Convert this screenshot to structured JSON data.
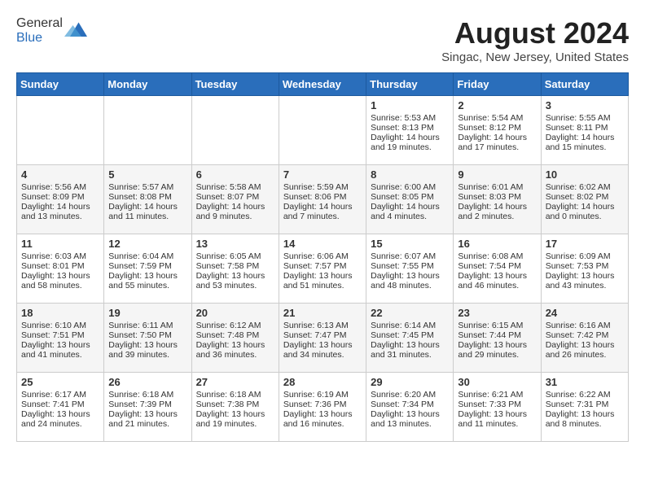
{
  "header": {
    "logo_general": "General",
    "logo_blue": "Blue",
    "month_title": "August 2024",
    "location": "Singac, New Jersey, United States"
  },
  "days_of_week": [
    "Sunday",
    "Monday",
    "Tuesday",
    "Wednesday",
    "Thursday",
    "Friday",
    "Saturday"
  ],
  "weeks": [
    [
      {
        "day": "",
        "content": ""
      },
      {
        "day": "",
        "content": ""
      },
      {
        "day": "",
        "content": ""
      },
      {
        "day": "",
        "content": ""
      },
      {
        "day": "1",
        "content": "Sunrise: 5:53 AM\nSunset: 8:13 PM\nDaylight: 14 hours\nand 19 minutes."
      },
      {
        "day": "2",
        "content": "Sunrise: 5:54 AM\nSunset: 8:12 PM\nDaylight: 14 hours\nand 17 minutes."
      },
      {
        "day": "3",
        "content": "Sunrise: 5:55 AM\nSunset: 8:11 PM\nDaylight: 14 hours\nand 15 minutes."
      }
    ],
    [
      {
        "day": "4",
        "content": "Sunrise: 5:56 AM\nSunset: 8:09 PM\nDaylight: 14 hours\nand 13 minutes."
      },
      {
        "day": "5",
        "content": "Sunrise: 5:57 AM\nSunset: 8:08 PM\nDaylight: 14 hours\nand 11 minutes."
      },
      {
        "day": "6",
        "content": "Sunrise: 5:58 AM\nSunset: 8:07 PM\nDaylight: 14 hours\nand 9 minutes."
      },
      {
        "day": "7",
        "content": "Sunrise: 5:59 AM\nSunset: 8:06 PM\nDaylight: 14 hours\nand 7 minutes."
      },
      {
        "day": "8",
        "content": "Sunrise: 6:00 AM\nSunset: 8:05 PM\nDaylight: 14 hours\nand 4 minutes."
      },
      {
        "day": "9",
        "content": "Sunrise: 6:01 AM\nSunset: 8:03 PM\nDaylight: 14 hours\nand 2 minutes."
      },
      {
        "day": "10",
        "content": "Sunrise: 6:02 AM\nSunset: 8:02 PM\nDaylight: 14 hours\nand 0 minutes."
      }
    ],
    [
      {
        "day": "11",
        "content": "Sunrise: 6:03 AM\nSunset: 8:01 PM\nDaylight: 13 hours\nand 58 minutes."
      },
      {
        "day": "12",
        "content": "Sunrise: 6:04 AM\nSunset: 7:59 PM\nDaylight: 13 hours\nand 55 minutes."
      },
      {
        "day": "13",
        "content": "Sunrise: 6:05 AM\nSunset: 7:58 PM\nDaylight: 13 hours\nand 53 minutes."
      },
      {
        "day": "14",
        "content": "Sunrise: 6:06 AM\nSunset: 7:57 PM\nDaylight: 13 hours\nand 51 minutes."
      },
      {
        "day": "15",
        "content": "Sunrise: 6:07 AM\nSunset: 7:55 PM\nDaylight: 13 hours\nand 48 minutes."
      },
      {
        "day": "16",
        "content": "Sunrise: 6:08 AM\nSunset: 7:54 PM\nDaylight: 13 hours\nand 46 minutes."
      },
      {
        "day": "17",
        "content": "Sunrise: 6:09 AM\nSunset: 7:53 PM\nDaylight: 13 hours\nand 43 minutes."
      }
    ],
    [
      {
        "day": "18",
        "content": "Sunrise: 6:10 AM\nSunset: 7:51 PM\nDaylight: 13 hours\nand 41 minutes."
      },
      {
        "day": "19",
        "content": "Sunrise: 6:11 AM\nSunset: 7:50 PM\nDaylight: 13 hours\nand 39 minutes."
      },
      {
        "day": "20",
        "content": "Sunrise: 6:12 AM\nSunset: 7:48 PM\nDaylight: 13 hours\nand 36 minutes."
      },
      {
        "day": "21",
        "content": "Sunrise: 6:13 AM\nSunset: 7:47 PM\nDaylight: 13 hours\nand 34 minutes."
      },
      {
        "day": "22",
        "content": "Sunrise: 6:14 AM\nSunset: 7:45 PM\nDaylight: 13 hours\nand 31 minutes."
      },
      {
        "day": "23",
        "content": "Sunrise: 6:15 AM\nSunset: 7:44 PM\nDaylight: 13 hours\nand 29 minutes."
      },
      {
        "day": "24",
        "content": "Sunrise: 6:16 AM\nSunset: 7:42 PM\nDaylight: 13 hours\nand 26 minutes."
      }
    ],
    [
      {
        "day": "25",
        "content": "Sunrise: 6:17 AM\nSunset: 7:41 PM\nDaylight: 13 hours\nand 24 minutes."
      },
      {
        "day": "26",
        "content": "Sunrise: 6:18 AM\nSunset: 7:39 PM\nDaylight: 13 hours\nand 21 minutes."
      },
      {
        "day": "27",
        "content": "Sunrise: 6:18 AM\nSunset: 7:38 PM\nDaylight: 13 hours\nand 19 minutes."
      },
      {
        "day": "28",
        "content": "Sunrise: 6:19 AM\nSunset: 7:36 PM\nDaylight: 13 hours\nand 16 minutes."
      },
      {
        "day": "29",
        "content": "Sunrise: 6:20 AM\nSunset: 7:34 PM\nDaylight: 13 hours\nand 13 minutes."
      },
      {
        "day": "30",
        "content": "Sunrise: 6:21 AM\nSunset: 7:33 PM\nDaylight: 13 hours\nand 11 minutes."
      },
      {
        "day": "31",
        "content": "Sunrise: 6:22 AM\nSunset: 7:31 PM\nDaylight: 13 hours\nand 8 minutes."
      }
    ]
  ]
}
